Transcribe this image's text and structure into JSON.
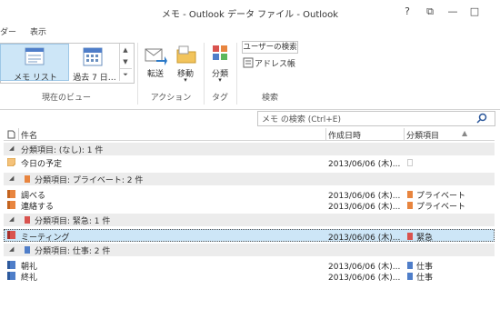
{
  "window": {
    "title": "メモ - Outlook データ ファイル - Outlook",
    "buttons": {
      "help": "?",
      "restore": "⧉",
      "minimize": "—",
      "maximize": "□"
    }
  },
  "menu": {
    "tab_left": "ダー",
    "tab_view": "表示"
  },
  "ribbon": {
    "gallery": {
      "item1": "メモ リスト",
      "item2": "過去 7 日…"
    },
    "groups": {
      "current_view": "現在のビュー",
      "actions": "アクション",
      "tags": "タグ",
      "search": "検索"
    },
    "buttons": {
      "forward": "転送",
      "move": "移動",
      "categorize": "分類",
      "search_people": "ユーザーの検索",
      "address_book": "アドレス帳"
    },
    "dropdown_arrow": "▾"
  },
  "search": {
    "placeholder": "メモ の検索 (Ctrl+E)"
  },
  "table": {
    "columns": {
      "subject": "件名",
      "created": "作成日時",
      "category": "分類項目"
    },
    "groups": [
      {
        "label": "分類項目: (なし): 1 件",
        "color": "",
        "rows": [
          {
            "subject": "今日の予定",
            "created": "2013/06/06 (木)...",
            "category": "",
            "color": "",
            "selected": false
          }
        ]
      },
      {
        "label": "分類項目: プライベート: 2 件",
        "color": "#e8853f",
        "rows": [
          {
            "subject": "調べる",
            "created": "2013/06/06 (木)...",
            "category": "プライベート",
            "color": "#e8853f",
            "selected": false
          },
          {
            "subject": "連絡する",
            "created": "2013/06/06 (木)...",
            "category": "プライベート",
            "color": "#e8853f",
            "selected": false
          }
        ]
      },
      {
        "label": "分類項目: 緊急: 1 件",
        "color": "#d9534f",
        "rows": [
          {
            "subject": "ミーティング",
            "created": "2013/06/06 (木)...",
            "category": "緊急",
            "color": "#d9534f",
            "selected": true
          }
        ]
      },
      {
        "label": "分類項目: 仕事: 2 件",
        "color": "#4f7ec9",
        "rows": [
          {
            "subject": "朝礼",
            "created": "2013/06/06 (木)...",
            "category": "仕事",
            "color": "#4f7ec9",
            "selected": false
          },
          {
            "subject": "終礼",
            "created": "2013/06/06 (木)...",
            "category": "仕事",
            "color": "#4f7ec9",
            "selected": false
          }
        ]
      }
    ]
  },
  "colors": {
    "selection": "#cde6f7",
    "group_bg": "#ececec",
    "accent": "#2b579a"
  }
}
